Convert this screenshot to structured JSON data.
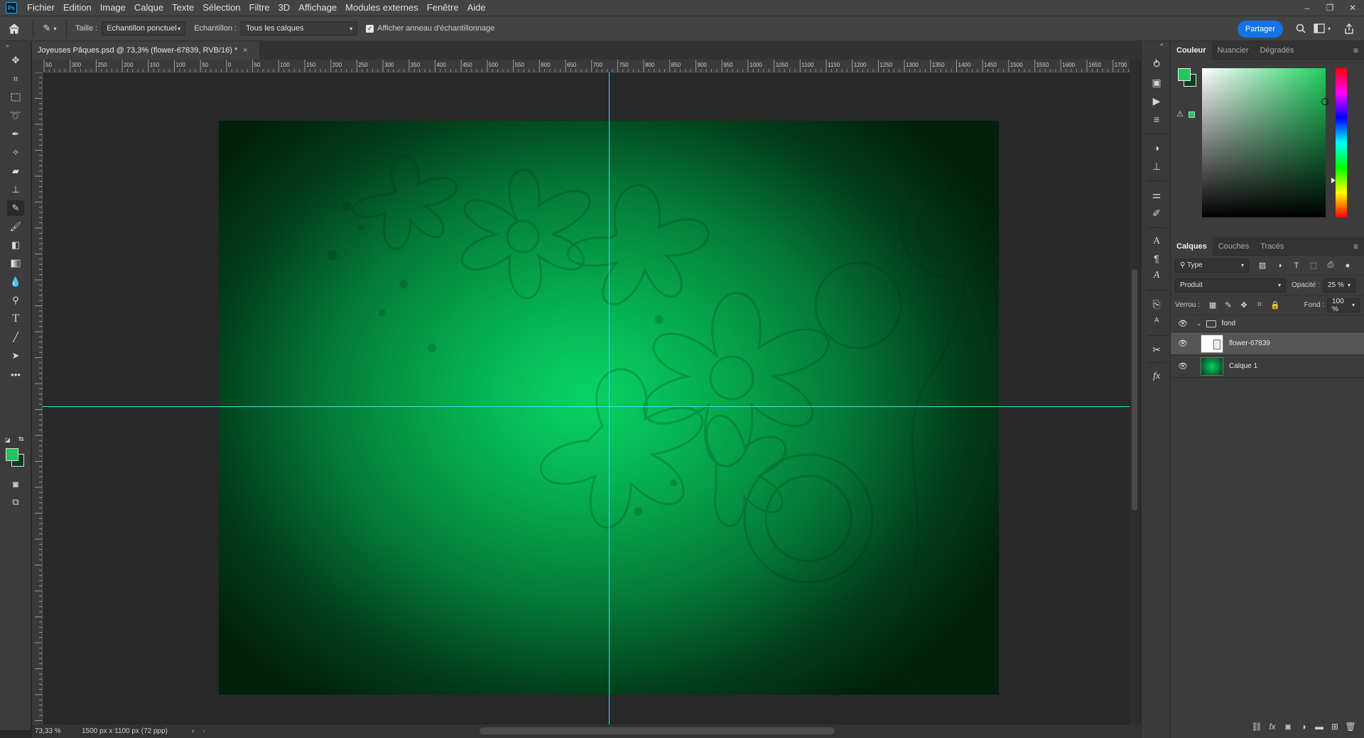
{
  "menubar": {
    "logo": "Ps",
    "items": [
      "Fichier",
      "Edition",
      "Image",
      "Calque",
      "Texte",
      "Sélection",
      "Filtre",
      "3D",
      "Affichage",
      "Modules externes",
      "Fenêtre",
      "Aide"
    ]
  },
  "optionsbar": {
    "size_label": "Taille :",
    "size_value": "Echantillon ponctuel",
    "sample_label": "Echantillon :",
    "sample_value": "Tous les calques",
    "ring_label": "Afficher anneau d'échantillonnage",
    "share_label": "Partager"
  },
  "document": {
    "tab_title": "Joyeuses Pâques.psd @ 73,3% (flower-67839, RVB/16) *",
    "zoom": "73,33 %",
    "doc_info": "1500 px x 1100 px (72 ppp)"
  },
  "ruler": {
    "h_labels": [
      "50",
      "300",
      "250",
      "200",
      "150",
      "100",
      "50",
      "0",
      "50",
      "100",
      "150",
      "200",
      "250",
      "300",
      "350",
      "400",
      "450",
      "500",
      "550",
      "600",
      "650",
      "700",
      "750",
      "800",
      "850",
      "900",
      "950",
      "1000",
      "1050",
      "1100",
      "1150",
      "1200",
      "1250",
      "1300",
      "1350",
      "1400",
      "1450",
      "1500",
      "1550",
      "1600",
      "1650",
      "1700"
    ]
  },
  "color_panel": {
    "tabs": [
      "Couleur",
      "Nuancier",
      "Dégradés"
    ],
    "foreground": "#22c55e",
    "background": "#0b3d27"
  },
  "layers_panel": {
    "tabs": [
      "Calques",
      "Couches",
      "Tracés"
    ],
    "filter_value": "Type",
    "blend_mode": "Produit",
    "opacity_label": "Opacité :",
    "opacity_value": "25 %",
    "lock_label": "Verrou :",
    "fill_label": "Fond :",
    "fill_value": "100 %",
    "layers": [
      {
        "name": "fond",
        "kind": "group"
      },
      {
        "name": "flower-67839",
        "kind": "smart-object",
        "selected": true
      },
      {
        "name": "Calque 1",
        "kind": "pixel"
      }
    ]
  },
  "colors": {
    "accent": "#1473e6",
    "guide": "#37e0e8",
    "canvas_green": "#06b052"
  }
}
